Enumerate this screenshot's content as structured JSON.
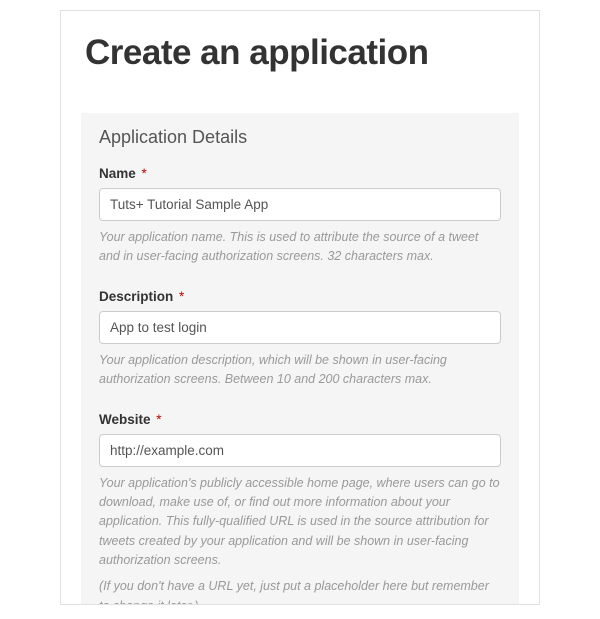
{
  "page_title": "Create an application",
  "section_title": "Application Details",
  "fields": {
    "name": {
      "label": "Name",
      "required_marker": "*",
      "value": "Tuts+ Tutorial Sample App",
      "help": "Your application name. This is used to attribute the source of a tweet and in user-facing authorization screens. 32 characters max."
    },
    "description": {
      "label": "Description",
      "required_marker": "*",
      "value": "App to test login",
      "help": "Your application description, which will be shown in user-facing authorization screens. Between 10 and 200 characters max."
    },
    "website": {
      "label": "Website",
      "required_marker": "*",
      "value": "http://example.com",
      "help": "Your application's publicly accessible home page, where users can go to download, make use of, or find out more information about your application. This fully-qualified URL is used in the source attribution for tweets created by your application and will be shown in user-facing authorization screens.",
      "help2": "(If you don't have a URL yet, just put a placeholder here but remember to change it later.)"
    }
  }
}
